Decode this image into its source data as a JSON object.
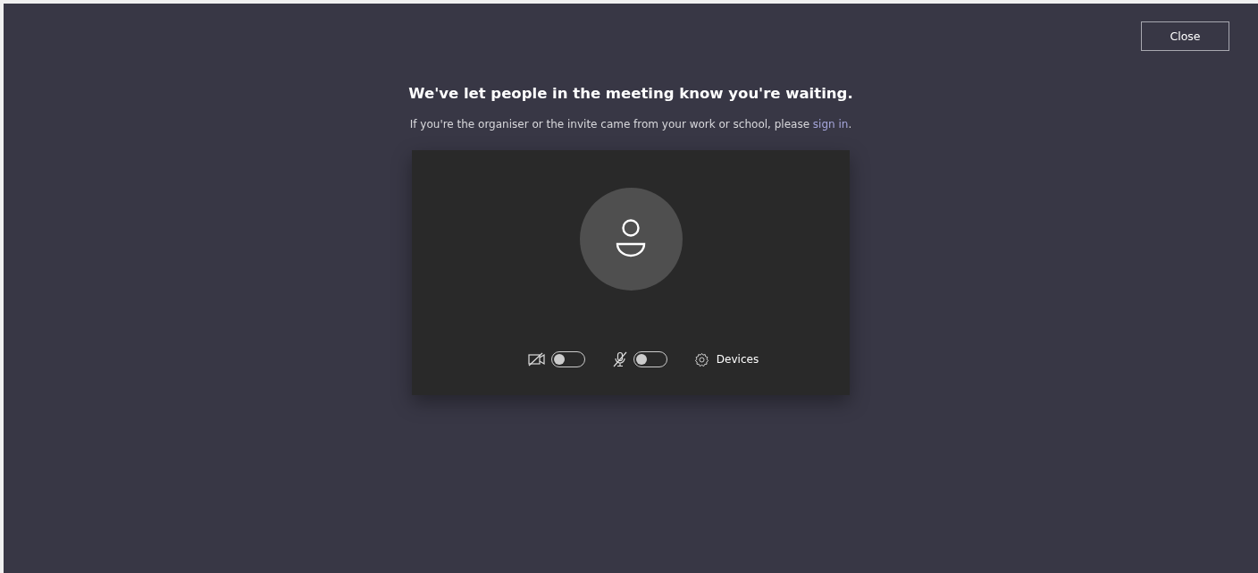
{
  "close_button": {
    "label": "Close"
  },
  "heading": "We've let people in the meeting know you're waiting.",
  "prompt": {
    "text": "If you're the organiser or the invite came from your work or school, please ",
    "link": "sign in",
    "end": "."
  },
  "preview": {
    "toggles": [
      {
        "kind": "camera",
        "on": false
      },
      {
        "kind": "microphone",
        "on": false
      }
    ],
    "devices_button": {
      "label": "Devices"
    }
  }
}
